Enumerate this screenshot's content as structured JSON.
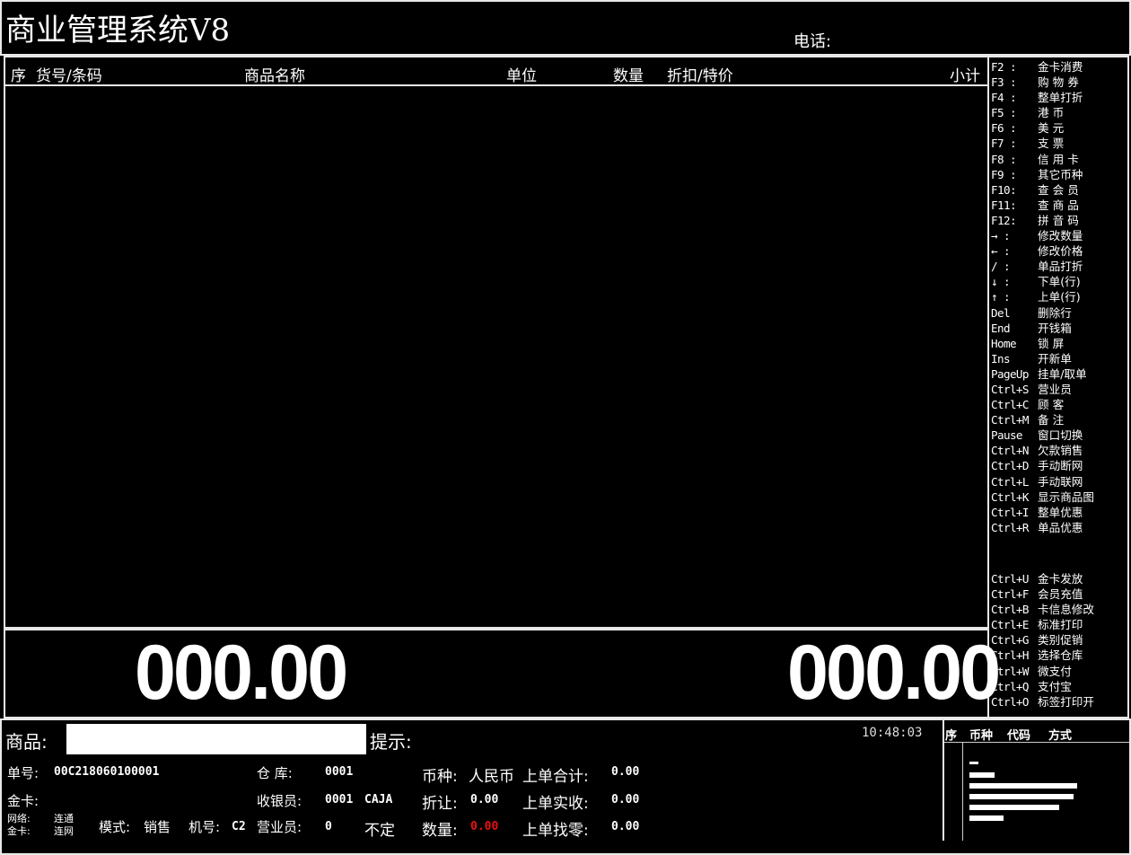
{
  "app": {
    "title": "商业管理系统V8",
    "phone_label": "电话:"
  },
  "grid": {
    "columns": [
      "序",
      "货号/条码",
      "商品名称",
      "单位",
      "数量",
      "折扣/特价",
      "小计"
    ]
  },
  "hotkeys": [
    {
      "key": "F2 :",
      "label": "金卡消费"
    },
    {
      "key": "F3 :",
      "label": "购 物 券"
    },
    {
      "key": "F4 :",
      "label": "整单打折"
    },
    {
      "key": "F5 :",
      "label": "港    币"
    },
    {
      "key": "F6 :",
      "label": "美    元"
    },
    {
      "key": "F7 :",
      "label": "支    票"
    },
    {
      "key": "F8 :",
      "label": "信 用 卡"
    },
    {
      "key": "F9 :",
      "label": "其它币种"
    },
    {
      "key": "F10:",
      "label": "查 会 员"
    },
    {
      "key": "F11:",
      "label": "查 商 品"
    },
    {
      "key": "F12:",
      "label": "拼 音 码"
    },
    {
      "key": "→ :",
      "label": "修改数量"
    },
    {
      "key": "← :",
      "label": "修改价格"
    },
    {
      "key": "/ :",
      "label": "单品打折"
    },
    {
      "key": "↓ :",
      "label": "下单(行)"
    },
    {
      "key": "↑ :",
      "label": "上单(行)"
    },
    {
      "key": "Del",
      "label": "删除行"
    },
    {
      "key": "End",
      "label": "开钱箱"
    },
    {
      "key": "Home",
      "label": "锁  屏"
    },
    {
      "key": "Ins",
      "label": "开新单"
    },
    {
      "key": "PageUp",
      "label": "挂单/取单"
    },
    {
      "key": "Ctrl+S",
      "label": "营业员"
    },
    {
      "key": "Ctrl+C",
      "label": "顾  客"
    },
    {
      "key": "Ctrl+M",
      "label": "备  注"
    },
    {
      "key": "Pause",
      "label": "窗口切换"
    },
    {
      "key": "Ctrl+N",
      "label": "欠款销售"
    },
    {
      "key": "Ctrl+D",
      "label": "手动断网"
    },
    {
      "key": "Ctrl+L",
      "label": "手动联网"
    },
    {
      "key": "Ctrl+K",
      "label": "显示商品图"
    },
    {
      "key": "Ctrl+I",
      "label": "整单优惠"
    },
    {
      "key": "Ctrl+R",
      "label": "单品优惠"
    }
  ],
  "hotkeys2": [
    {
      "key": "Ctrl+U",
      "label": "金卡发放"
    },
    {
      "key": "Ctrl+F",
      "label": "会员充值"
    },
    {
      "key": "Ctrl+B",
      "label": "卡信息修改"
    },
    {
      "key": "Ctrl+E",
      "label": "标准打印"
    },
    {
      "key": "Ctrl+G",
      "label": "类别促销"
    },
    {
      "key": "Ctrl+H",
      "label": "选择仓库"
    },
    {
      "key": "Ctrl+W",
      "label": "微支付"
    },
    {
      "key": "Ctrl+Q",
      "label": "支付宝"
    },
    {
      "key": "Ctrl+O",
      "label": "标签打印开"
    }
  ],
  "totals": {
    "left": "000.00",
    "right": "000.00"
  },
  "bottom": {
    "goods_label": "商品:",
    "goods_value": "",
    "hint_label": "提示:",
    "time": "10:48:03",
    "order_no_label": "单号:",
    "order_no": "00C218060100001",
    "warehouse_label": "仓  库:",
    "warehouse": "0001",
    "currency_label": "币种:",
    "currency": "人民币",
    "last_total_label": "上单合计:",
    "last_total": "0.00",
    "gold_card_label": "金卡:",
    "cashier_label": "收银员:",
    "cashier": "0001",
    "cashier_name": "CAJA",
    "discount_label": "折让:",
    "discount": "0.00",
    "last_paid_label": "上单实收:",
    "last_paid": "0.00",
    "network_label": "网络:",
    "network_status": "连通",
    "card_label": "金卡:",
    "card_status": "连网",
    "mode_label": "模式:",
    "mode": "销售",
    "machine_label": "机号:",
    "machine": "C2",
    "salesman_label": "营业员:",
    "salesman": "0",
    "unfixed": "不定",
    "qty_label": "数量:",
    "qty": "0.00",
    "last_change_label": "上单找零:",
    "last_change": "0.00",
    "pay_header": [
      "序",
      "币种",
      "代码",
      "方式"
    ]
  }
}
